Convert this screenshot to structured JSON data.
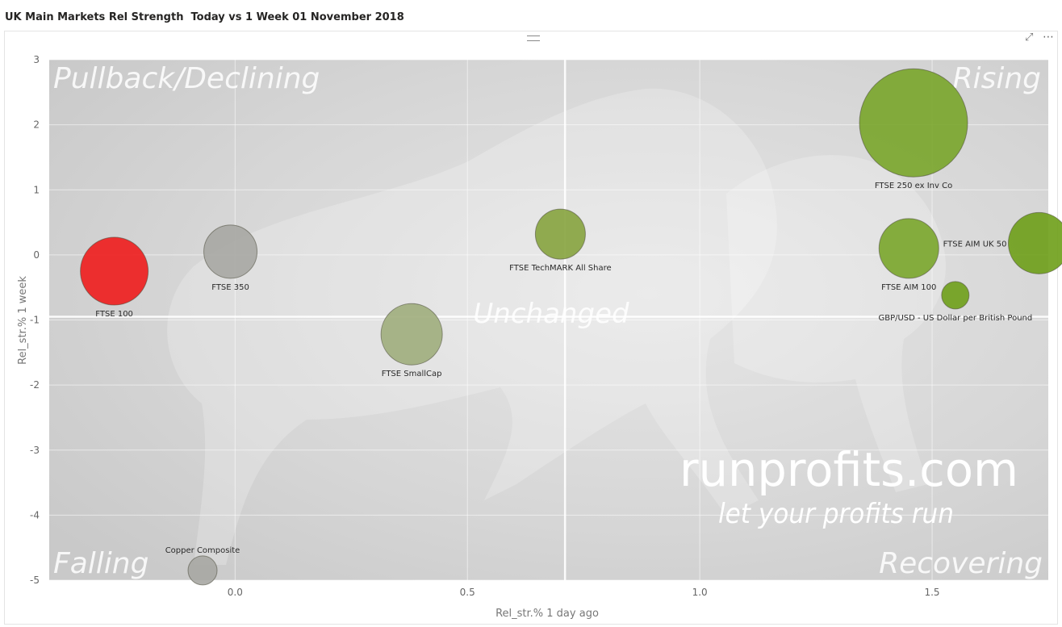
{
  "page_title": "UK Main Markets Rel Strength  Today vs 1 Week 01 November 2018",
  "header_icons": [
    "focus-mode-icon",
    "more-options-icon"
  ],
  "background": {
    "quadrants": {
      "top_left": "Pullback/Declining",
      "top_right": "Rising",
      "bottom_left": "Falling",
      "bottom_right": "Recovering",
      "center": "Unchanged"
    },
    "brand": "runprofits.com",
    "tagline": "let your profits run"
  },
  "colors": {
    "red": "#ee1c1c",
    "grey": "#a7a7a3",
    "olive_pale": "#9fad7c",
    "olive": "#86a33e",
    "green": "#79a52a",
    "green_strong": "#6e9f18"
  },
  "chart_data": {
    "type": "scatter",
    "subtype": "bubble",
    "xlabel": "Rel_str.% 1 day ago",
    "ylabel": "Rel_str.% 1 week",
    "xlim": [
      -0.4,
      1.75
    ],
    "ylim": [
      -5,
      3
    ],
    "xticks": [
      "0.0",
      "0.5",
      "1.0",
      "1.5"
    ],
    "xtick_values": [
      0.0,
      0.5,
      1.0,
      1.5
    ],
    "yticks": [
      "3",
      "2",
      "1",
      "0",
      "-1",
      "-2",
      "-3",
      "-4",
      "-5"
    ],
    "ytick_values": [
      3,
      2,
      1,
      0,
      -1,
      -2,
      -3,
      -4,
      -5
    ],
    "grid": true,
    "points": [
      {
        "name": "FTSE 100",
        "x": -0.26,
        "y": -0.25,
        "size": 42,
        "color": "#ee1c1c"
      },
      {
        "name": "FTSE 350",
        "x": -0.01,
        "y": 0.05,
        "size": 33,
        "color": "#a7a7a3"
      },
      {
        "name": "FTSE SmallCap",
        "x": 0.38,
        "y": -1.22,
        "size": 38,
        "color": "#9fad7c"
      },
      {
        "name": "FTSE TechMARK All Share",
        "x": 0.7,
        "y": 0.32,
        "size": 31,
        "color": "#86a33e"
      },
      {
        "name": "FTSE 250 ex Inv Co",
        "x": 1.46,
        "y": 2.03,
        "size": 67,
        "color": "#79a52a"
      },
      {
        "name": "FTSE AIM 100",
        "x": 1.45,
        "y": 0.1,
        "size": 37,
        "color": "#79a52a"
      },
      {
        "name": "FTSE AIM UK 50",
        "x": 1.73,
        "y": 0.18,
        "size": 38,
        "color": "#6e9f18"
      },
      {
        "name": "GBP/USD - US Dollar per British Pound",
        "x": 1.55,
        "y": -0.62,
        "size": 17,
        "color": "#6e9f18"
      },
      {
        "name": "Copper Composite",
        "x": -0.07,
        "y": -4.85,
        "size": 18,
        "color": "#a7a7a3"
      }
    ],
    "reference_lines": {
      "vertical_x": 0.71,
      "horizontal_y": -0.95
    }
  }
}
